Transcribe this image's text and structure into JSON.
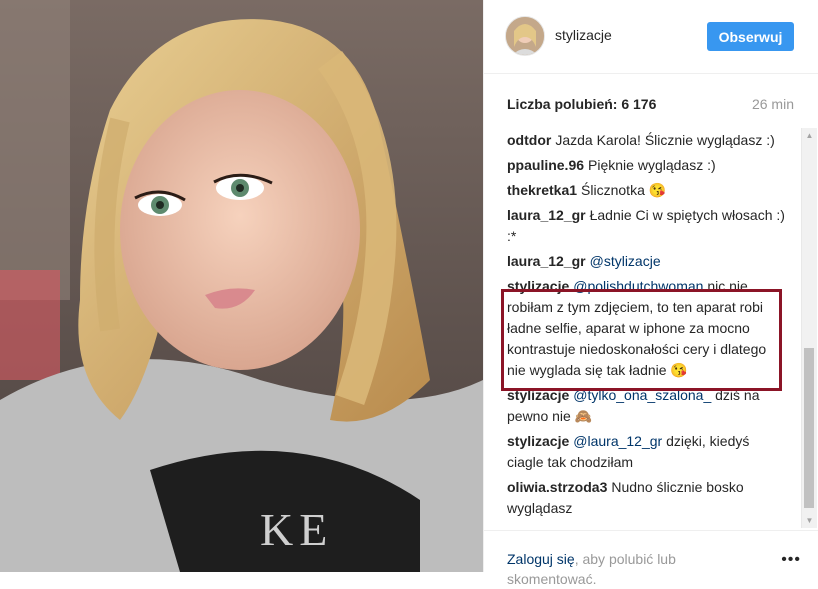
{
  "post": {
    "username": "stylizacje",
    "follow_label": "Obserwuj",
    "likes": "Liczba polubień: 6 176",
    "time": "26 min"
  },
  "comments": [
    {
      "author": "odtdor",
      "mention": "",
      "text": "Jazda Karola! Ślicznie wyglądasz :)"
    },
    {
      "author": "ppauline.96",
      "mention": "",
      "text": "Pięknie wyglądasz :)"
    },
    {
      "author": "thekretka1",
      "mention": "",
      "text": "Ślicznotka 😘"
    },
    {
      "author": "laura_12_gr",
      "mention": "",
      "text": "Ładnie Ci w spiętych włosach :) :*"
    },
    {
      "author": "laura_12_gr",
      "mention": "@stylizacje",
      "text": ""
    },
    {
      "author": "stylizacje",
      "mention": "@polishdutchwoman",
      "text": "nic nie robiłam z tym zdjęciem, to ten aparat robi ładne selfie, aparat w iphone za mocno kontrastuje niedoskonałości cery i dlatego nie wyglada się tak ładnie 😘"
    },
    {
      "author": "stylizacje",
      "mention": "@tylko_ona_szalona_",
      "text": "dziś na pewno nie 🙈"
    },
    {
      "author": "stylizacje",
      "mention": "@laura_12_gr",
      "text": "dzięki, kiedyś ciagle tak chodziłam"
    },
    {
      "author": "oliwia.strzoda3",
      "mention": "",
      "text": "Nudno ślicznie bosko wyglądasz"
    }
  ],
  "footer": {
    "login_link": "Zaloguj się",
    "login_text": ", aby polubić lub skomentować."
  },
  "icons": {
    "more": "more-options-icon"
  },
  "colors": {
    "accent": "#3897f0",
    "highlight": "#8b1426",
    "mention": "#003569"
  }
}
